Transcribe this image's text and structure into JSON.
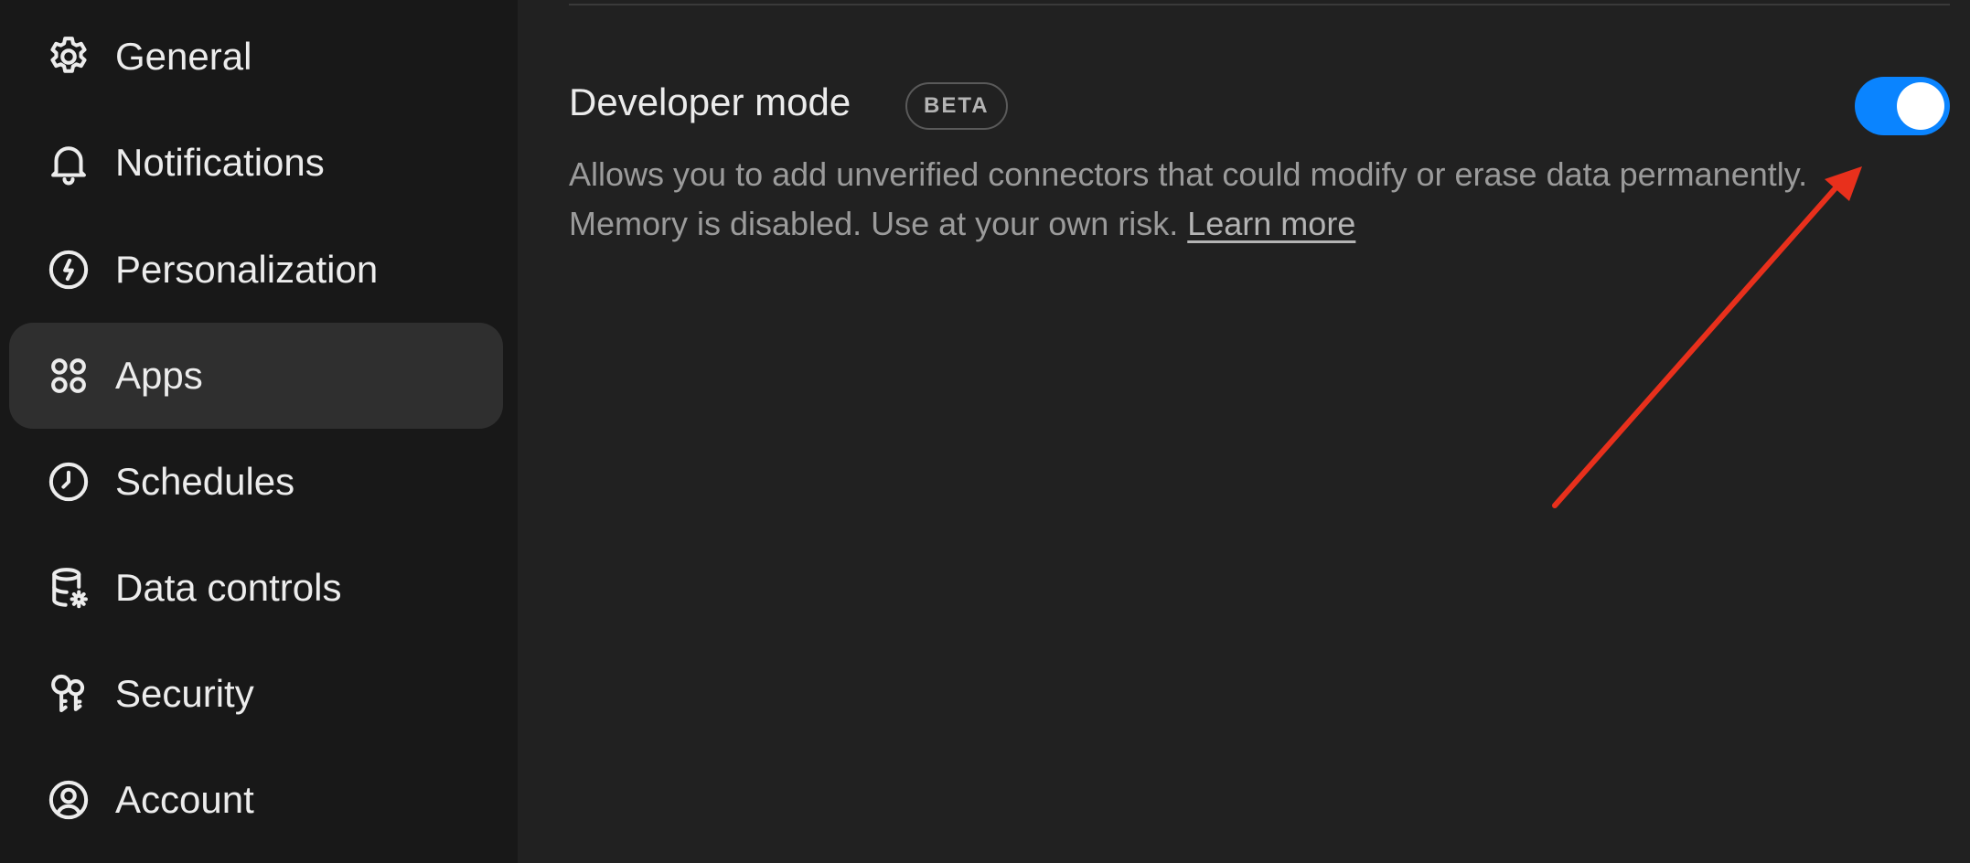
{
  "sidebar": {
    "items": [
      {
        "label": "General",
        "icon": "gear-icon"
      },
      {
        "label": "Notifications",
        "icon": "bell-icon"
      },
      {
        "label": "Personalization",
        "icon": "personalization-icon"
      },
      {
        "label": "Apps",
        "icon": "apps-grid-icon",
        "active": true
      },
      {
        "label": "Schedules",
        "icon": "clock-icon"
      },
      {
        "label": "Data controls",
        "icon": "database-gear-icon"
      },
      {
        "label": "Security",
        "icon": "keys-icon"
      },
      {
        "label": "Account",
        "icon": "user-circle-icon"
      }
    ]
  },
  "setting": {
    "title": "Developer mode",
    "badge": "BETA",
    "description": "Allows you to add unverified connectors that could modify or erase data permanently. Memory is disabled. Use at your own risk.",
    "learn_more": "Learn more",
    "enabled": true
  },
  "colors": {
    "toggle_on": "#0a84ff",
    "annotation_arrow": "#e8301c",
    "active_item_bg": "#2f2f2f"
  }
}
